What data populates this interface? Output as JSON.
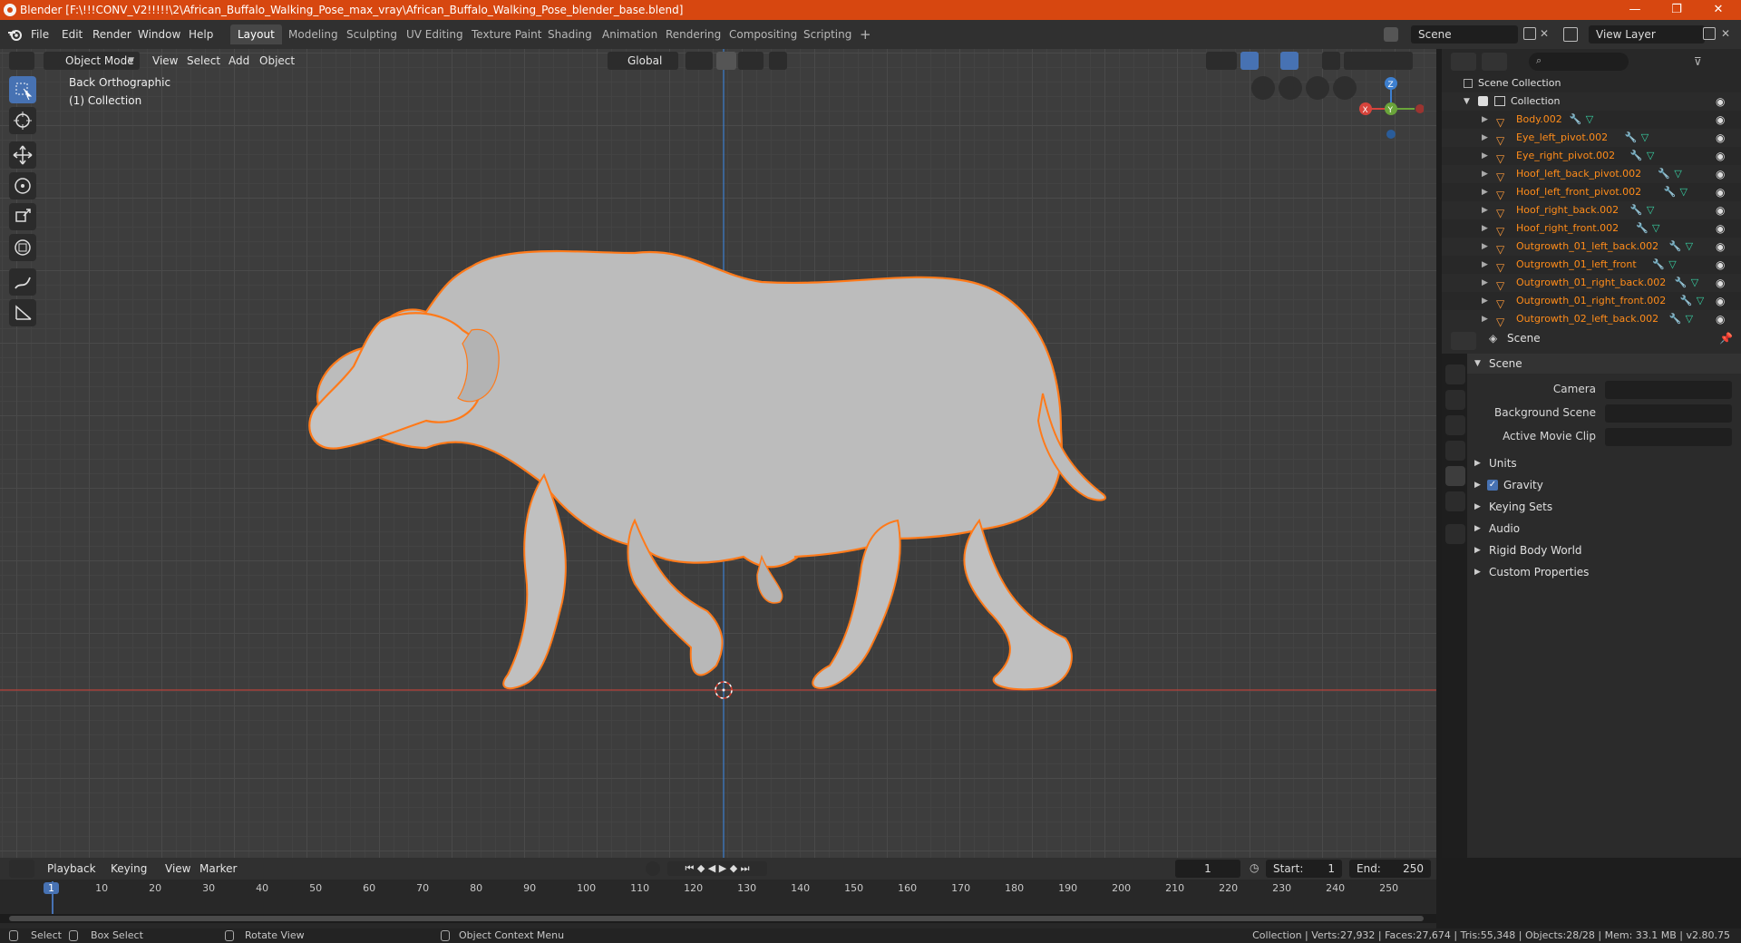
{
  "window": {
    "title": "Blender [F:\\!!!CONV_V2!!!!!\\2\\African_Buffalo_Walking_Pose_max_vray\\African_Buffalo_Walking_Pose_blender_base.blend]",
    "minimize": "—",
    "maximize": "❐",
    "close": "✕"
  },
  "menu": [
    "File",
    "Edit",
    "Render",
    "Window",
    "Help"
  ],
  "workspaces": [
    "Layout",
    "Modeling",
    "Sculpting",
    "UV Editing",
    "Texture Paint",
    "Shading",
    "Animation",
    "Rendering",
    "Compositing",
    "Scripting"
  ],
  "workspace_add": "+",
  "scene_field": "Scene",
  "view_layer_field": "View Layer",
  "viewport": {
    "mode": "Object Mode",
    "menus": [
      "View",
      "Select",
      "Add",
      "Object"
    ],
    "orientation": "Global",
    "view_name": "Back Orthographic",
    "collection_label": "(1) Collection",
    "gizmo": {
      "z": "Z",
      "y": "Y",
      "x": "X"
    },
    "accent_selected": "#ff7a1a"
  },
  "outliner": {
    "root": "Scene Collection",
    "collection": "Collection",
    "objects": [
      "Body.002",
      "Eye_left_pivot.002",
      "Eye_right_pivot.002",
      "Hoof_left_back_pivot.002",
      "Hoof_left_front_pivot.002",
      "Hoof_right_back.002",
      "Hoof_right_front.002",
      "Outgrowth_01_left_back.002",
      "Outgrowth_01_left_front",
      "Outgrowth_01_right_back.002",
      "Outgrowth_01_right_front.002",
      "Outgrowth_02_left_back.002"
    ]
  },
  "properties": {
    "context": "Scene",
    "panel": "Scene",
    "camera_label": "Camera",
    "background_scene_label": "Background Scene",
    "active_movie_clip_label": "Active Movie Clip",
    "sections": [
      "Units",
      "Gravity",
      "Keying Sets",
      "Audio",
      "Rigid Body World",
      "Custom Properties"
    ],
    "gravity_checked": true
  },
  "timeline": {
    "menus": [
      "Playback",
      "Keying",
      "View",
      "Marker"
    ],
    "current_frame": "1",
    "start_label": "Start:",
    "start": "1",
    "end_label": "End:",
    "end": "250",
    "ticks": [
      "1",
      "10",
      "20",
      "30",
      "40",
      "50",
      "60",
      "70",
      "80",
      "90",
      "100",
      "110",
      "120",
      "130",
      "140",
      "150",
      "160",
      "170",
      "180",
      "190",
      "200",
      "210",
      "220",
      "230",
      "240",
      "250"
    ]
  },
  "statusbar": {
    "select": "Select",
    "box_select": "Box Select",
    "rotate_view": "Rotate View",
    "context_menu": "Object Context Menu",
    "stats": "Collection | Verts:27,932 | Faces:27,674 | Tris:55,348 | Objects:28/28 | Mem: 33.1 MB | v2.80.75"
  }
}
